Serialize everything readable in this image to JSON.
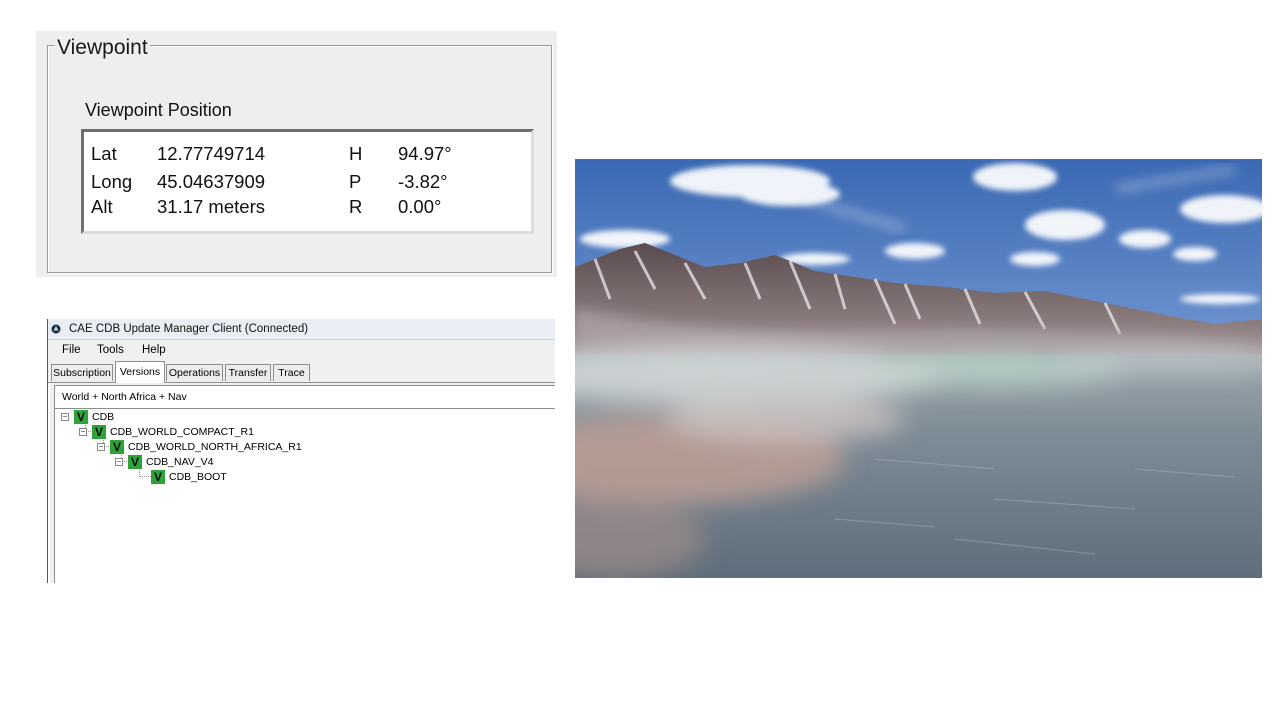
{
  "viewpoint": {
    "title": "Viewpoint",
    "position_label": "Viewpoint Position",
    "rows": [
      {
        "k1": "Lat",
        "v1": "12.77749714",
        "k2": "H",
        "v2": "94.97°"
      },
      {
        "k1": "Long",
        "v1": "45.04637909",
        "k2": "P",
        "v2": "-3.82°"
      },
      {
        "k1": "Alt",
        "v1": "31.17 meters",
        "k2": "R",
        "v2": "0.00°"
      }
    ]
  },
  "update_manager": {
    "title": "CAE CDB Update Manager Client (Connected)",
    "menu": [
      "File",
      "Tools",
      "Help"
    ],
    "tabs": [
      "Subscription",
      "Versions",
      "Operations",
      "Transfer",
      "Trace"
    ],
    "active_tab": "Versions",
    "tree_header": "World + North Africa + Nav",
    "check_glyph": "V",
    "tree": [
      {
        "label": "CDB",
        "level": 0
      },
      {
        "label": "CDB_WORLD_COMPACT_R1",
        "level": 1
      },
      {
        "label": "CDB_WORLD_NORTH_AFRICA_R1",
        "level": 2
      },
      {
        "label": "CDB_NAV_V4",
        "level": 3
      },
      {
        "label": "CDB_BOOT",
        "level": 4
      }
    ],
    "colors": {
      "check": "#2da33a"
    }
  },
  "terrain": {
    "colors": {
      "sky_top": "#3f6fb8",
      "sky_horizon": "#b9cde8",
      "water": "#6f7d8a"
    }
  }
}
